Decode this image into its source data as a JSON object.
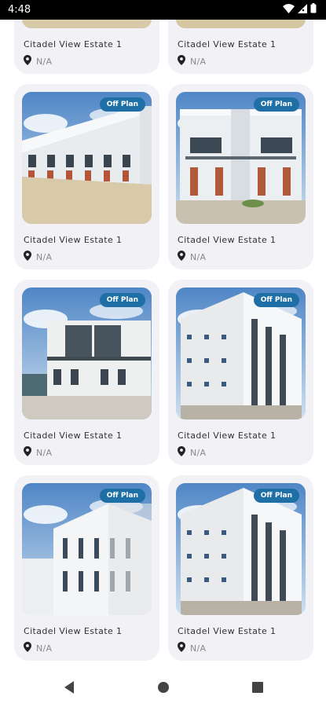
{
  "status_bar": {
    "time": "4:48",
    "icons": [
      "wifi-icon",
      "signal-icon",
      "battery-icon"
    ]
  },
  "listings": [
    {
      "title": "Citadel View Estate 1",
      "location": "N/A",
      "badge": "",
      "image": "townhouse-row-angled"
    },
    {
      "title": "Citadel View Estate 1",
      "location": "N/A",
      "badge": "",
      "image": "townhouse-row-street"
    },
    {
      "title": "Citadel View Estate 1",
      "location": "N/A",
      "badge": "Off Plan",
      "image": "townhouse-row-angled"
    },
    {
      "title": "Citadel View Estate 1",
      "location": "N/A",
      "badge": "Off Plan",
      "image": "townhouse-front"
    },
    {
      "title": "Citadel View Estate 1",
      "location": "N/A",
      "badge": "Off Plan",
      "image": "duplex-dark-front"
    },
    {
      "title": "Citadel View Estate 1",
      "location": "N/A",
      "badge": "Off Plan",
      "image": "apartment-block"
    },
    {
      "title": "Citadel View Estate 1",
      "location": "N/A",
      "badge": "Off Plan",
      "image": "apartment-block-side"
    },
    {
      "title": "Citadel View Estate 1",
      "location": "N/A",
      "badge": "Off Plan",
      "image": "apartment-block"
    }
  ],
  "nav": {
    "buttons": [
      "back-icon",
      "home-icon",
      "recents-icon"
    ]
  },
  "colors": {
    "badge": "#1f6fa7",
    "card_bg": "#f1f1f6",
    "title_text": "#333333",
    "location_text": "#8a8a8a"
  }
}
